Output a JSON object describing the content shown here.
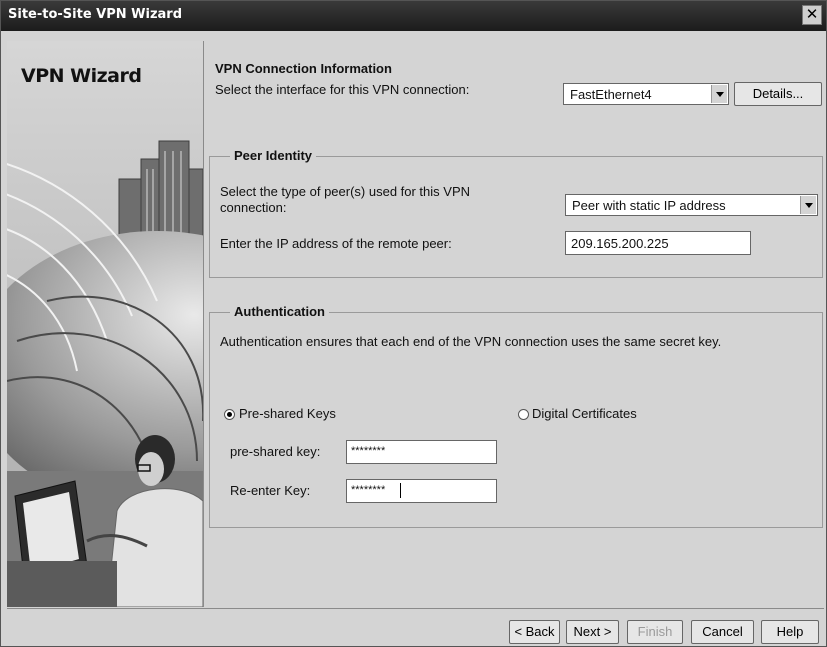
{
  "window": {
    "title": "Site-to-Site VPN Wizard",
    "close_glyph": "✕"
  },
  "sidebar": {
    "title": "VPN Wizard"
  },
  "connection": {
    "title": "VPN Connection Information",
    "interface_label": "Select the interface for this VPN connection:",
    "interface_value": "FastEthernet4",
    "details_label": "Details..."
  },
  "peer": {
    "legend": "Peer Identity",
    "type_label_line1": "Select the type of peer(s) used for this VPN",
    "type_label_line2": "connection:",
    "type_value": "Peer with static IP address",
    "ip_label": "Enter the IP address of the remote peer:",
    "ip_value": "209.165.200.225"
  },
  "auth": {
    "legend": "Authentication",
    "description": "Authentication ensures that each end of the VPN connection uses the same secret key.",
    "preshared_label": "Pre-shared Keys",
    "preshared_selected": true,
    "certs_label": "Digital Certificates",
    "key_label": "pre-shared key:",
    "key_value": "********",
    "reenter_label": "Re-enter Key:",
    "reenter_value": "********"
  },
  "footer": {
    "back": "< Back",
    "next": "Next >",
    "finish": "Finish",
    "cancel": "Cancel",
    "help": "Help"
  }
}
